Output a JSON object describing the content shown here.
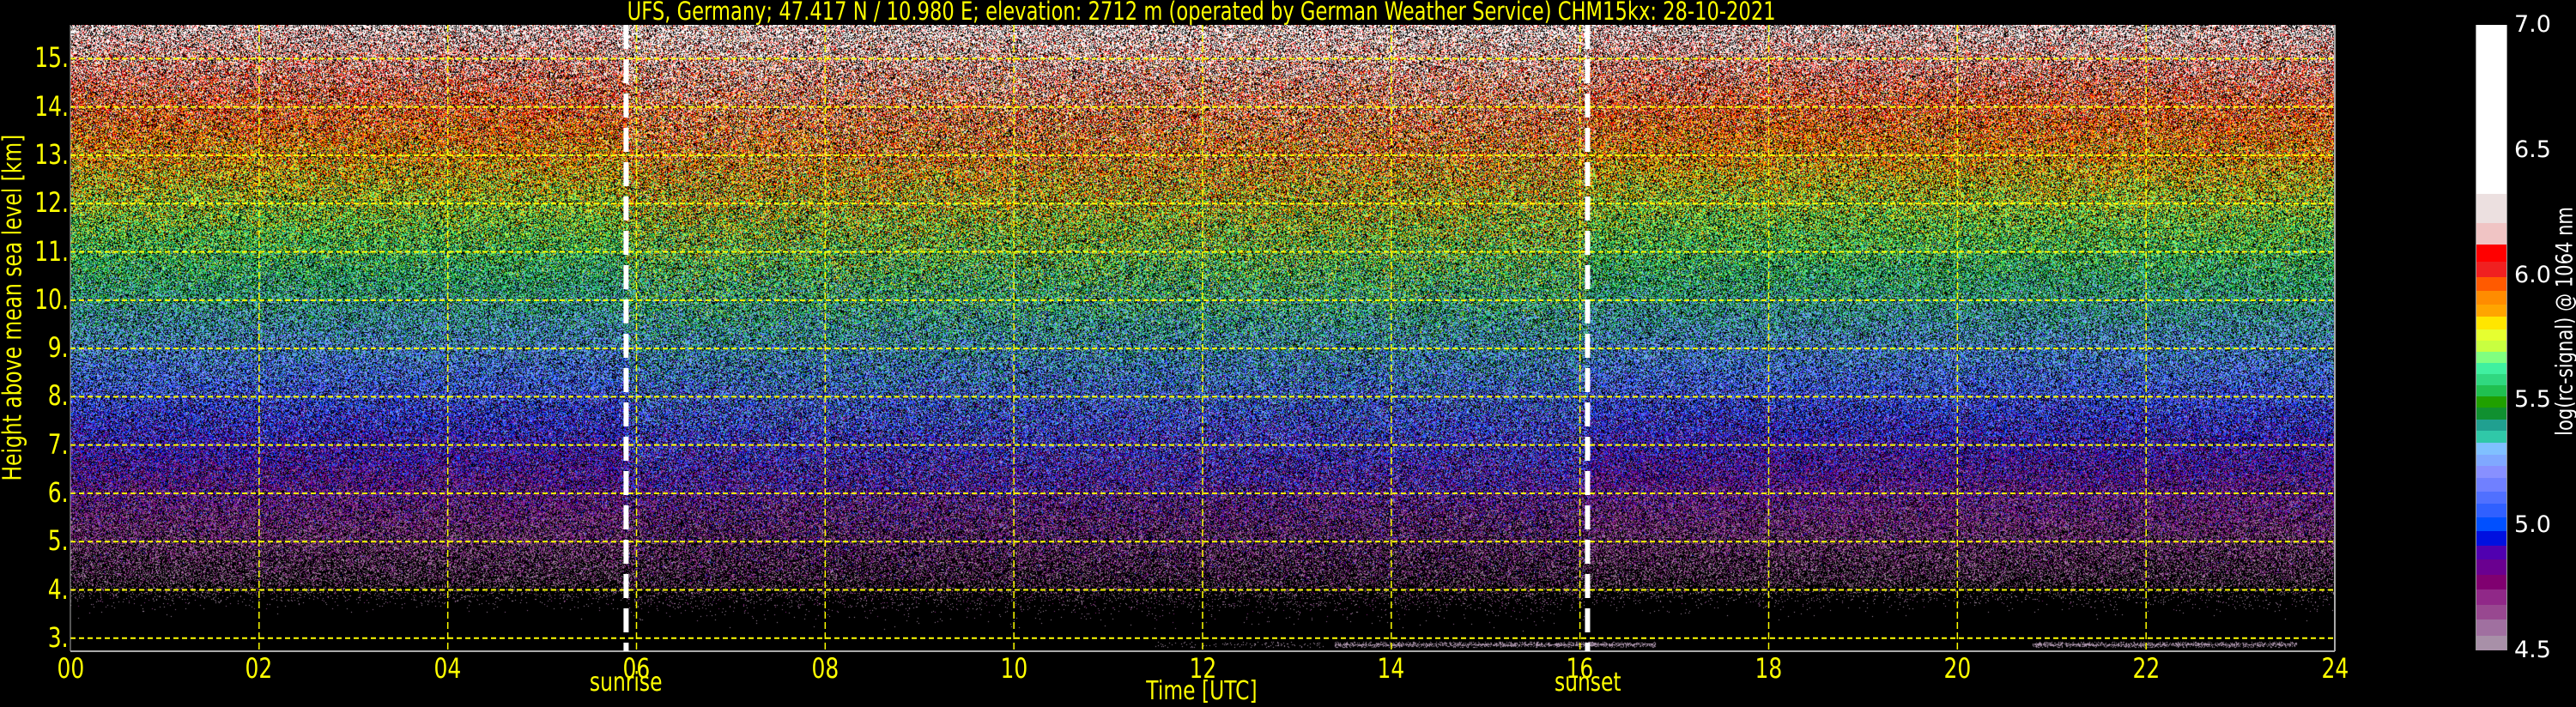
{
  "chart_data": {
    "type": "heatmap",
    "title": "UFS, Germany; 47.417 N / 10.980 E; elevation: 2712 m  (operated by German Weather Service)    CHM15kx: 28-10-2021",
    "xlabel": "Time [UTC]",
    "ylabel": "Height above mean sea level [km]",
    "xlim": [
      0,
      24
    ],
    "ylim": [
      2.73,
      15.7
    ],
    "x_ticks": [
      "00",
      "02",
      "04",
      "06",
      "08",
      "10",
      "12",
      "14",
      "16",
      "18",
      "20",
      "22",
      "24"
    ],
    "x_tick_values": [
      0,
      2,
      4,
      6,
      8,
      10,
      12,
      14,
      16,
      18,
      20,
      22,
      24
    ],
    "y_ticks": [
      "3.",
      "4.",
      "5.",
      "6.",
      "7.",
      "8.",
      "9.",
      "10.",
      "11.",
      "12.",
      "13.",
      "14.",
      "15."
    ],
    "y_tick_values": [
      3,
      4,
      5,
      6,
      7,
      8,
      9,
      10,
      11,
      12,
      13,
      14,
      15
    ],
    "grid": true,
    "grid_color": "#ffff00",
    "annotations": [
      {
        "label": "sunrise",
        "time_h": 5.89
      },
      {
        "label": "sunset",
        "time_h": 16.08
      }
    ],
    "low_layers": [
      {
        "height_km": 2.87,
        "from_h": 11.5,
        "to_h": 13.3,
        "strength": 0.15
      },
      {
        "height_km": 2.87,
        "from_h": 13.4,
        "to_h": 16.8,
        "strength": 0.7
      },
      {
        "height_km": 2.87,
        "from_h": 20.8,
        "to_h": 23.6,
        "strength": 0.7
      }
    ],
    "colorbar": {
      "label": "log(rc-signal) @ 1064 nm",
      "range": [
        4.5,
        7.0
      ],
      "ticks": [
        "7.0",
        "6.5",
        "6.0",
        "5.5",
        "5.0",
        "4.5"
      ],
      "tick_values": [
        7.0,
        6.5,
        6.0,
        5.5,
        5.0,
        4.5
      ],
      "bands": [
        {
          "from": 4.5,
          "color": "#a890a8"
        },
        {
          "from": 4.559,
          "color": "#a070a0"
        },
        {
          "from": 4.622,
          "color": "#984890"
        },
        {
          "from": 4.681,
          "color": "#902888"
        },
        {
          "from": 4.742,
          "color": "#800070"
        },
        {
          "from": 4.802,
          "color": "#6a0090"
        },
        {
          "from": 4.865,
          "color": "#5000b0"
        },
        {
          "from": 4.919,
          "color": "#0010e0"
        },
        {
          "from": 4.977,
          "color": "#0050ff"
        },
        {
          "from": 5.032,
          "color": "#3060ff"
        },
        {
          "from": 5.085,
          "color": "#5070ff"
        },
        {
          "from": 5.135,
          "color": "#7080ff"
        },
        {
          "from": 5.189,
          "color": "#8890ff"
        },
        {
          "from": 5.238,
          "color": "#80a8ff"
        },
        {
          "from": 5.283,
          "color": "#80c0ff"
        },
        {
          "from": 5.33,
          "color": "#30c8a8"
        },
        {
          "from": 5.378,
          "color": "#20a090"
        },
        {
          "from": 5.423,
          "color": "#109030"
        },
        {
          "from": 5.472,
          "color": "#20a000"
        },
        {
          "from": 5.514,
          "color": "#20c050"
        },
        {
          "from": 5.559,
          "color": "#30d880"
        },
        {
          "from": 5.604,
          "color": "#40f0a0"
        },
        {
          "from": 5.649,
          "color": "#80ff80"
        },
        {
          "from": 5.694,
          "color": "#c8ff40"
        },
        {
          "from": 5.739,
          "color": "#e6ff30"
        },
        {
          "from": 5.784,
          "color": "#ffe600"
        },
        {
          "from": 5.834,
          "color": "#ffa500"
        },
        {
          "from": 5.883,
          "color": "#ff8c00"
        },
        {
          "from": 5.937,
          "color": "#ff5a00"
        },
        {
          "from": 5.991,
          "color": "#f02020"
        },
        {
          "from": 6.054,
          "color": "#ff0000"
        },
        {
          "from": 6.122,
          "color": "#f0c4c4"
        },
        {
          "from": 6.207,
          "color": "#ece0e0"
        },
        {
          "from": 6.324,
          "color": "#ffffff"
        }
      ]
    }
  }
}
